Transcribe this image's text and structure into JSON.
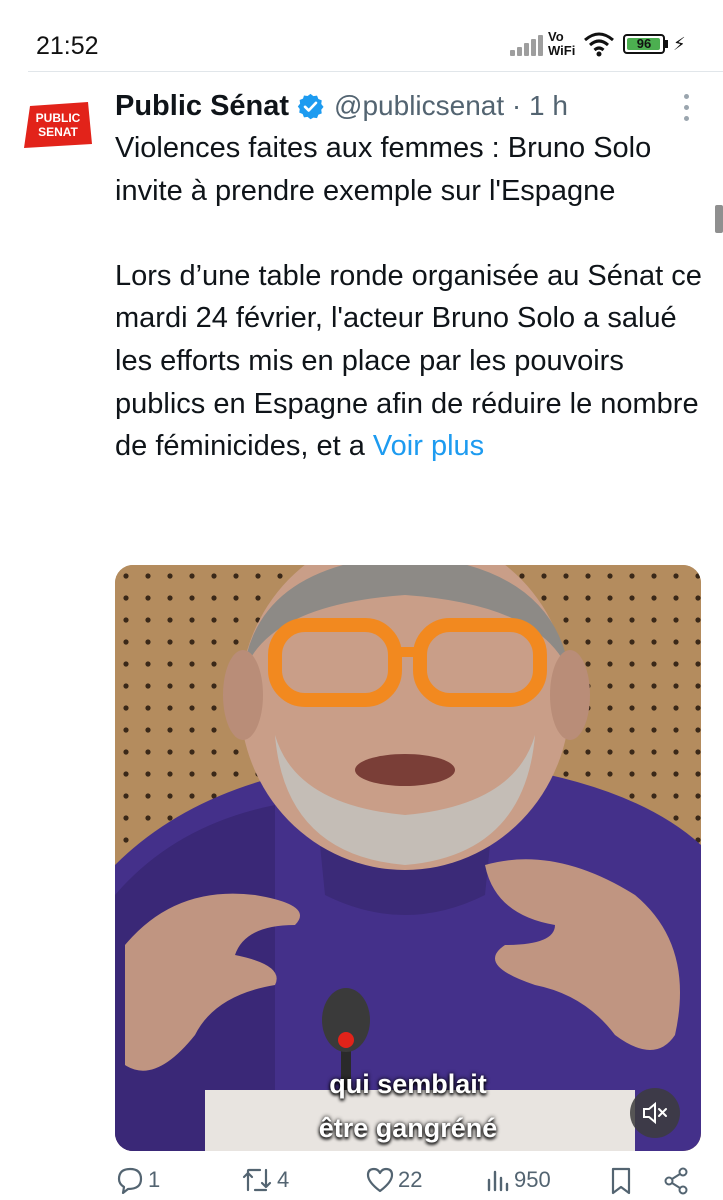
{
  "status_bar": {
    "time": "21:52",
    "vowifi_top": "Vo",
    "vowifi_bottom": "WiFi",
    "battery": "96",
    "icons": [
      "signal-icon",
      "wifi-icon",
      "battery-icon",
      "charging-bolt-icon"
    ]
  },
  "tweet": {
    "author_name": "Public Sénat",
    "handle": "@publicsenat · 1 h",
    "avatar_logo_text": [
      "PUBLIC",
      "SENAT"
    ],
    "text_title": "Violences faites aux femmes : Bruno Solo invite à prendre exemple sur l'Espagne",
    "text_body": "Lors d’une table ronde organisée au Sénat ce mardi 24 février, l'acteur Bruno Solo a salué les efforts mis en place par les pouvoirs publics en Espagne afin de réduire le nombre de féminicides, et a",
    "voir_plus": "Voir plus",
    "media": {
      "caption_line1": "qui semblait",
      "caption_line2": "être gangréné"
    }
  },
  "actions": {
    "replies": "1",
    "retweets": "4",
    "likes": "22",
    "views": "950"
  },
  "colors": {
    "accent": "#1d9bf0",
    "text": "#0f1419",
    "secondary": "#536471",
    "logo_red": "#e2231a",
    "battery_green": "#4caf50"
  }
}
